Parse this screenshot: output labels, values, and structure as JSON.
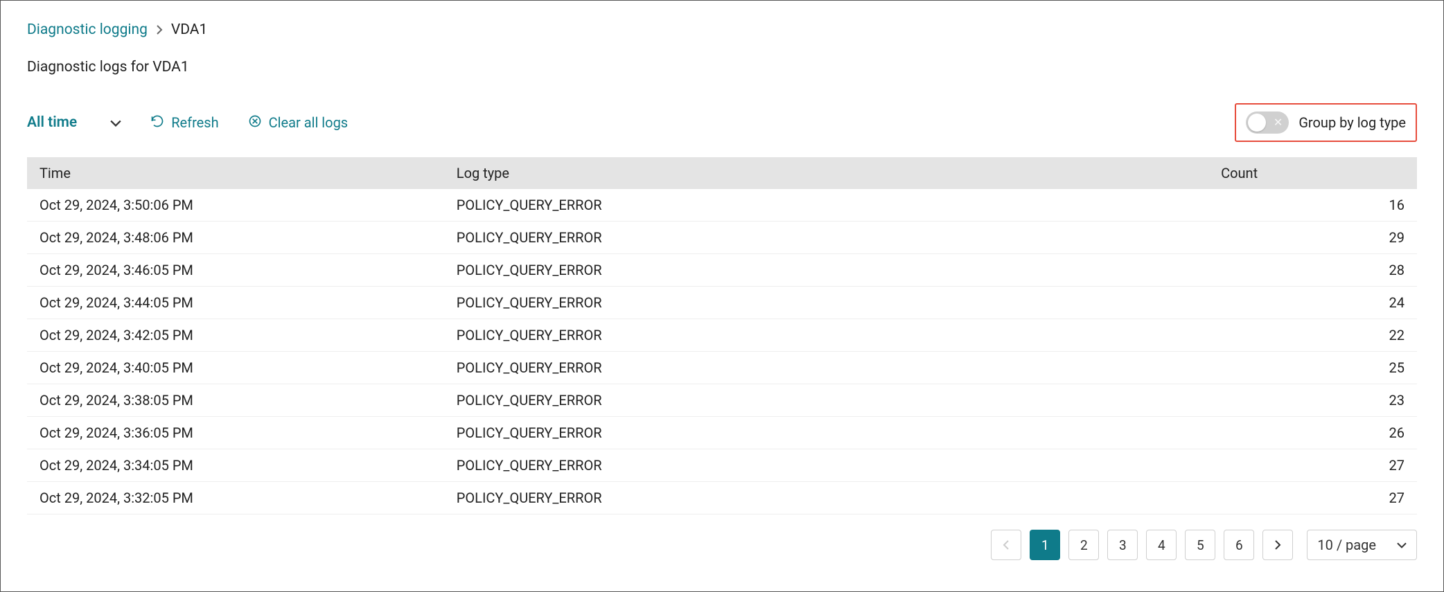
{
  "breadcrumb": {
    "parent": "Diagnostic logging",
    "current": "VDA1"
  },
  "page_title": "Diagnostic logs for VDA1",
  "toolbar": {
    "time_filter": "All time",
    "refresh": "Refresh",
    "clear": "Clear all logs",
    "group_toggle_label": "Group by log type"
  },
  "columns": {
    "time": "Time",
    "log_type": "Log type",
    "count": "Count"
  },
  "rows": [
    {
      "time": "Oct 29, 2024, 3:50:06 PM",
      "log_type": "POLICY_QUERY_ERROR",
      "count": 16
    },
    {
      "time": "Oct 29, 2024, 3:48:06 PM",
      "log_type": "POLICY_QUERY_ERROR",
      "count": 29
    },
    {
      "time": "Oct 29, 2024, 3:46:05 PM",
      "log_type": "POLICY_QUERY_ERROR",
      "count": 28
    },
    {
      "time": "Oct 29, 2024, 3:44:05 PM",
      "log_type": "POLICY_QUERY_ERROR",
      "count": 24
    },
    {
      "time": "Oct 29, 2024, 3:42:05 PM",
      "log_type": "POLICY_QUERY_ERROR",
      "count": 22
    },
    {
      "time": "Oct 29, 2024, 3:40:05 PM",
      "log_type": "POLICY_QUERY_ERROR",
      "count": 25
    },
    {
      "time": "Oct 29, 2024, 3:38:05 PM",
      "log_type": "POLICY_QUERY_ERROR",
      "count": 23
    },
    {
      "time": "Oct 29, 2024, 3:36:05 PM",
      "log_type": "POLICY_QUERY_ERROR",
      "count": 26
    },
    {
      "time": "Oct 29, 2024, 3:34:05 PM",
      "log_type": "POLICY_QUERY_ERROR",
      "count": 27
    },
    {
      "time": "Oct 29, 2024, 3:32:05 PM",
      "log_type": "POLICY_QUERY_ERROR",
      "count": 27
    }
  ],
  "pagination": {
    "pages": [
      1,
      2,
      3,
      4,
      5,
      6
    ],
    "active": 1,
    "page_size_label": "10 / page"
  }
}
